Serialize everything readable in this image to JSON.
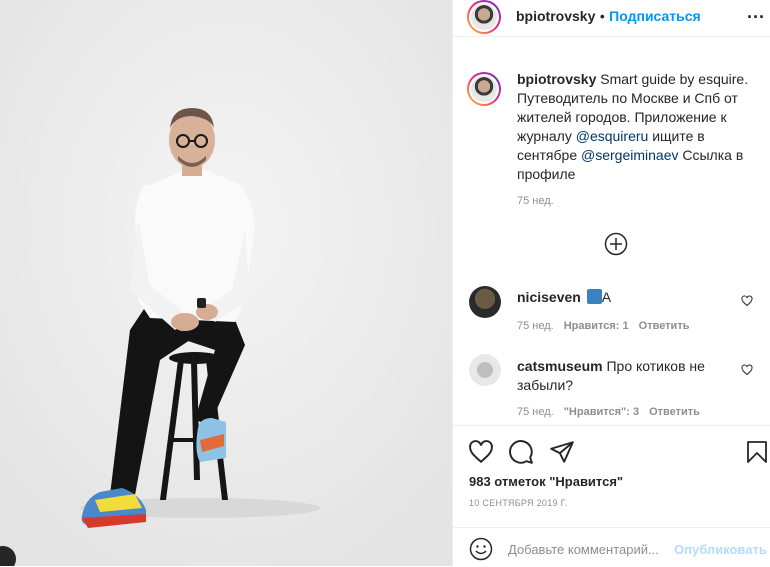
{
  "post": {
    "author": "bpiotrovsky",
    "separator": "•",
    "follow_label": "Подписаться",
    "more_label": "...",
    "caption_author": "bpiotrovsky",
    "caption_part1": "Smart guide by esquire. Путеводитель по Москве и Спб от жителей городов. Приложение к журналу ",
    "caption_mention1": "@esquireru",
    "caption_part2": " ищите в сентябре ",
    "caption_mention2": "@sergeiminaev",
    "caption_part3": " Ссылка в профиле",
    "caption_time": "75 нед.",
    "likes": "983 отметок \"Нравится\"",
    "date": "10 СЕНТЯБРЯ 2019 Г."
  },
  "comments": [
    {
      "user": "niciseven",
      "text": "А",
      "time": "75 нед.",
      "likes": "Нравится: 1",
      "reply": "Ответить"
    },
    {
      "user": "catsmuseum",
      "text": "Про котиков не забыли?",
      "time": "75 нед.",
      "likes": "\"Нравится\": 3",
      "reply": "Ответить"
    }
  ],
  "comment_input": {
    "placeholder": "Добавьте комментарий...",
    "submit_label": "Опубликовать"
  },
  "colors": {
    "accent": "#0095f6",
    "mention": "#00376b",
    "muted": "#8e8e8e",
    "submit_disabled": "#b3dbff"
  },
  "icons": [
    "more-icon",
    "load-more-icon",
    "heart-icon",
    "comment-icon",
    "share-icon",
    "bookmark-icon",
    "emoji-icon",
    "emoji-badge-icon"
  ]
}
